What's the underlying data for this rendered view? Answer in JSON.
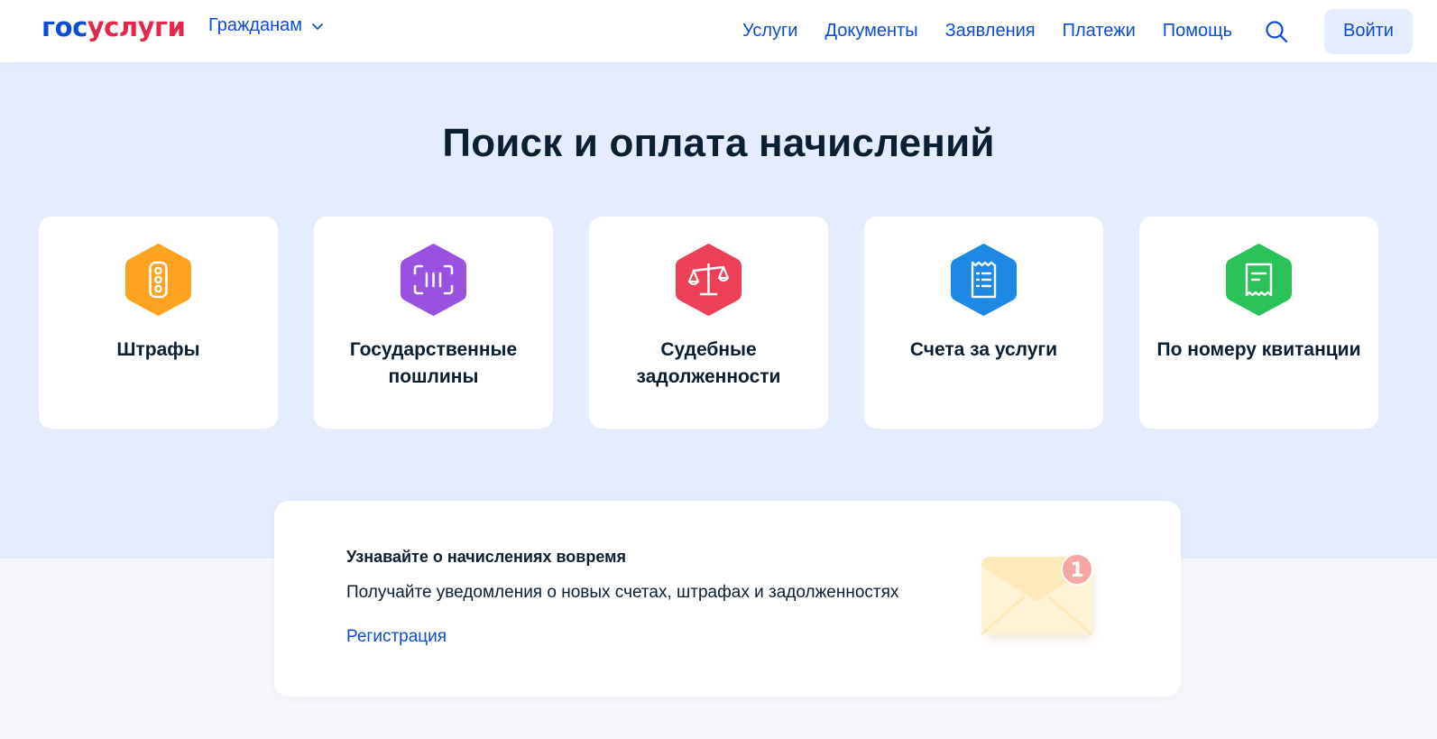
{
  "header": {
    "logo_part1": "гос",
    "logo_part2": "услуги",
    "audience_label": "Гражданам",
    "nav": [
      "Услуги",
      "Документы",
      "Заявления",
      "Платежи",
      "Помощь"
    ],
    "login_label": "Войти"
  },
  "hero": {
    "title": "Поиск и оплата начислений"
  },
  "categories": [
    {
      "label": "Штрафы",
      "icon": "traffic-light-icon",
      "color": "#ffa220"
    },
    {
      "label": "Государственные пошлины",
      "icon": "barcode-scan-icon",
      "color": "#9b51e0"
    },
    {
      "label": "Судебные задолженности",
      "icon": "scales-icon",
      "color": "#ee3f58"
    },
    {
      "label": "Счета за услуги",
      "icon": "bill-icon",
      "color": "#1e88e5"
    },
    {
      "label": "По номеру квитанции",
      "icon": "receipt-icon",
      "color": "#2bc25a"
    }
  ],
  "notify": {
    "title": "Узнавайте о начислениях вовремя",
    "text": "Получайте уведомления о новых счетах, штрафах и задолженностях",
    "link": "Регистрация",
    "badge": "1"
  },
  "colors": {
    "brand_blue": "#0d4cd3",
    "brand_red": "#e3284b",
    "hero_bg": "#e4ecfd",
    "text": "#0b1f33"
  }
}
